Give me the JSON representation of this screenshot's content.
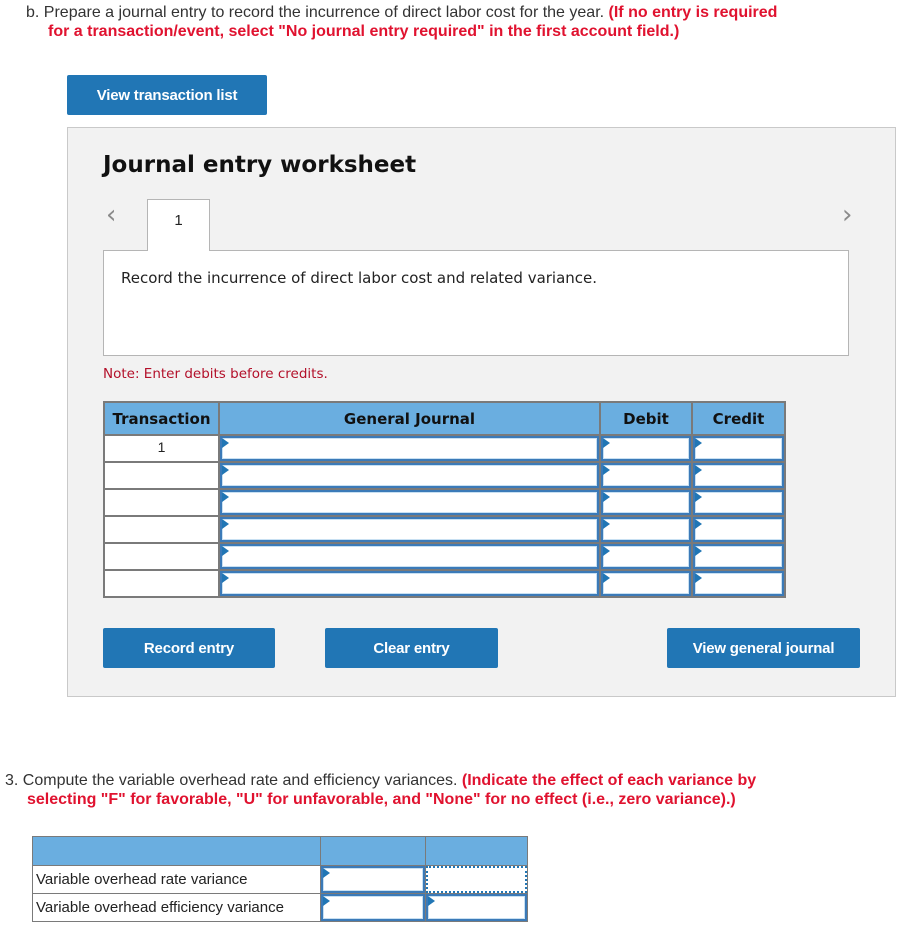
{
  "question_b": {
    "prefix": "b. ",
    "text": "Prepare a journal entry to record the incurrence of direct labor cost for the year. ",
    "instruction_line1": "(If no entry is required",
    "instruction_line2": "for a transaction/event, select \"No journal entry required\" in the first account field.)"
  },
  "buttons": {
    "view_transaction_list": "View transaction list",
    "record_entry": "Record entry",
    "clear_entry": "Clear entry",
    "view_general_journal": "View general journal"
  },
  "worksheet": {
    "title": "Journal entry worksheet",
    "prev_icon": "chevron-left-icon",
    "next_icon": "chevron-right-icon",
    "tabs": [
      {
        "label": "1",
        "active": true
      }
    ],
    "description": "Record the incurrence of direct labor cost and related variance.",
    "note": "Note: Enter debits before credits.",
    "table": {
      "headers": [
        "Transaction",
        "General Journal",
        "Debit",
        "Credit"
      ],
      "rows": [
        {
          "transaction": "1",
          "account": "",
          "debit": "",
          "credit": ""
        },
        {
          "transaction": "",
          "account": "",
          "debit": "",
          "credit": ""
        },
        {
          "transaction": "",
          "account": "",
          "debit": "",
          "credit": ""
        },
        {
          "transaction": "",
          "account": "",
          "debit": "",
          "credit": ""
        },
        {
          "transaction": "",
          "account": "",
          "debit": "",
          "credit": ""
        },
        {
          "transaction": "",
          "account": "",
          "debit": "",
          "credit": ""
        }
      ]
    }
  },
  "question_3": {
    "text": "3. Compute the variable overhead rate and efficiency variances. ",
    "instruction_line1": "(Indicate the effect of each variance by",
    "instruction_line2": "selecting \"F\" for favorable, \"U\" for unfavorable, and \"None\" for no effect (i.e., zero variance).)"
  },
  "variance_table": {
    "headers": [
      "",
      "",
      ""
    ],
    "rows": [
      {
        "label": "Variable overhead rate variance",
        "amount": "",
        "effect": ""
      },
      {
        "label": "Variable overhead efficiency variance",
        "amount": "",
        "effect": ""
      }
    ]
  },
  "colors": {
    "button_blue": "#2176b5",
    "header_blue": "#6aaee0",
    "instruction_red": "#e0122f",
    "note_red": "#b3102a"
  }
}
